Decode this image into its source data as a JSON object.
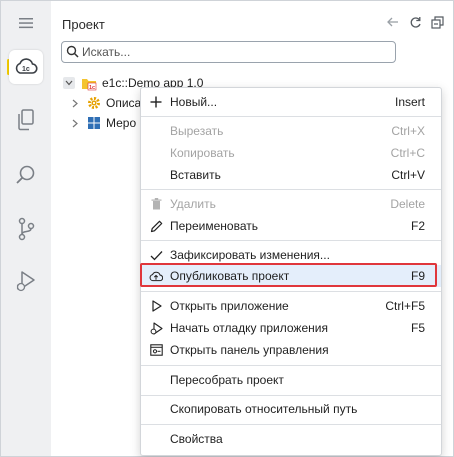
{
  "panel": {
    "title": "Проект",
    "search_placeholder": "Искать..."
  },
  "activity_bar": {
    "items": [
      "hamburger-icon",
      "cloud-1c-icon",
      "files-icon",
      "search-icon",
      "source-control-icon",
      "run-debug-icon"
    ],
    "accent": "#f2cc00"
  },
  "tree": {
    "root": "e1c::Demo app 1.0",
    "children": [
      "Описа",
      "Меро"
    ]
  },
  "context_menu": {
    "items": [
      {
        "label": "Новый...",
        "shortcut": "Insert",
        "icon": "plus-icon",
        "enabled": true
      },
      {
        "label": "Вырезать",
        "shortcut": "Ctrl+X",
        "enabled": false
      },
      {
        "label": "Копировать",
        "shortcut": "Ctrl+C",
        "enabled": false
      },
      {
        "label": "Вставить",
        "shortcut": "Ctrl+V",
        "enabled": true
      },
      {
        "label": "Удалить",
        "shortcut": "Delete",
        "icon": "trash-icon",
        "enabled": false
      },
      {
        "label": "Переименовать",
        "shortcut": "F2",
        "icon": "pencil-icon",
        "enabled": true
      },
      {
        "label": "Зафиксировать изменения...",
        "shortcut": "",
        "icon": "check-icon",
        "enabled": true
      },
      {
        "label": "Опубликовать проект",
        "shortcut": "F9",
        "icon": "cloud-upload-icon",
        "enabled": true,
        "highlighted": true
      },
      {
        "label": "Открыть приложение",
        "shortcut": "Ctrl+F5",
        "icon": "play-icon",
        "enabled": true
      },
      {
        "label": "Начать отладку приложения",
        "shortcut": "F5",
        "icon": "debug-play-icon",
        "enabled": true
      },
      {
        "label": "Открыть панель управления",
        "shortcut": "",
        "icon": "control-panel-icon",
        "enabled": true
      },
      {
        "label": "Пересобрать проект",
        "shortcut": "",
        "enabled": true
      },
      {
        "label": "Скопировать относительный путь",
        "shortcut": "",
        "enabled": true
      },
      {
        "label": "Свойства",
        "shortcut": "",
        "enabled": true
      }
    ]
  },
  "colors": {
    "highlight_border": "#e0363b",
    "highlight_bg": "#e4eefb",
    "disabled_text": "#a3a3a3"
  }
}
